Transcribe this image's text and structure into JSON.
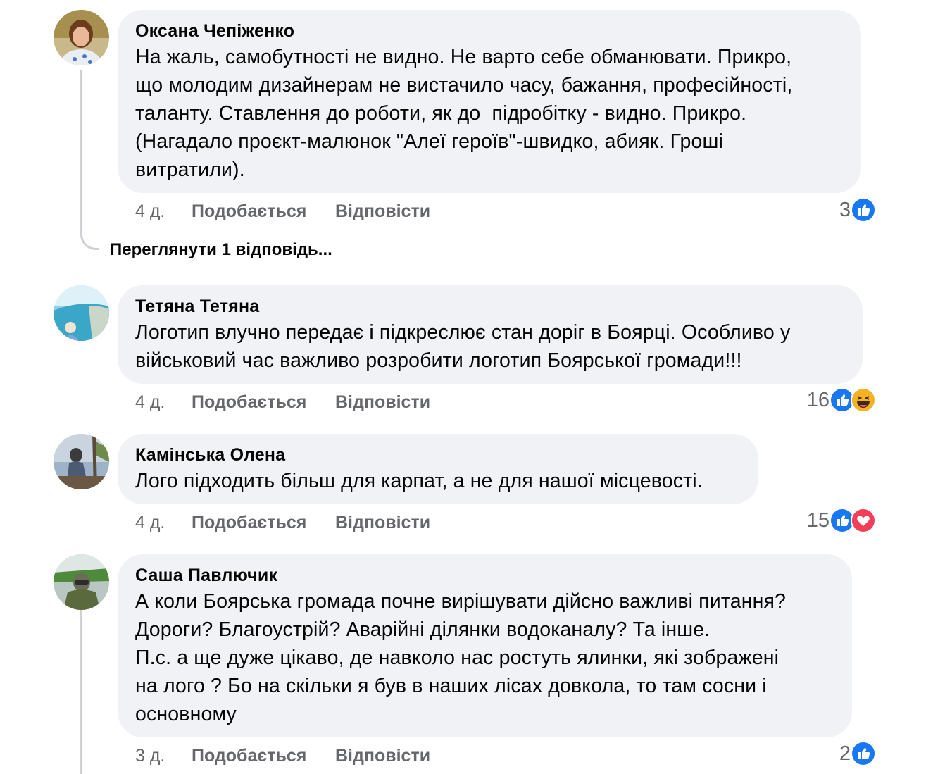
{
  "comments": [
    {
      "author": "Оксана Чепіженко",
      "lines": [
        "На жаль, самобутності не видно. Не варто себе обманювати. Прикро,",
        "що молодим дизайнерам не вистачило часу, бажання, професійності,",
        "таланту. Ставлення до роботи, як до  підробітку - видно. Прикро.",
        "(Нагадало проєкт-малюнок \"Алеї героїв\"-швидко, абияк. Гроші",
        "витратили)."
      ],
      "time": "4 д.",
      "like_label": "Подобається",
      "reply_label": "Відповісти",
      "reaction_count": "3",
      "reactions": [
        "like-icon"
      ]
    },
    {
      "author": "Тетяна Тетяна",
      "lines": [
        "Логотип влучно передає і підкреслює стан доріг в Боярці. Особливо у",
        "військовий час важливо розробити логотип Боярської громади!!!"
      ],
      "time": "4 д.",
      "like_label": "Подобається",
      "reply_label": "Відповісти",
      "reaction_count": "16",
      "reactions": [
        "like-icon",
        "haha-icon"
      ]
    },
    {
      "author": "Камінська Олена",
      "lines": [
        "Лого підходить більш для карпат, а не для нашої місцевості."
      ],
      "time": "4 д.",
      "like_label": "Подобається",
      "reply_label": "Відповісти",
      "reaction_count": "15",
      "reactions": [
        "like-icon",
        "love-icon"
      ]
    },
    {
      "author": "Саша Павлючик",
      "lines": [
        "А коли Боярська громада почне вирішувати дійсно важливі питання?",
        "Дороги? Благоустрій? Аварійні ділянки водоканалу? Та інше.",
        "П.с. а ще дуже цікаво, де навколо нас ростуть ялинки, які зображені",
        "на лого ? Бо на скільки я був в наших лісах довкола, то там сосни і",
        "основному"
      ],
      "time": "3 д.",
      "like_label": "Подобається",
      "reply_label": "Відповісти",
      "reaction_count": "2",
      "reactions": [
        "like-icon"
      ]
    }
  ],
  "view_replies": "Переглянути 1 відповідь...",
  "colors": {
    "bubble": "#f0f2f5",
    "meta_text": "#65676b",
    "like_blue": "#1877f2",
    "love_red": "#f33e58",
    "haha_yellow": "#f7b125"
  }
}
